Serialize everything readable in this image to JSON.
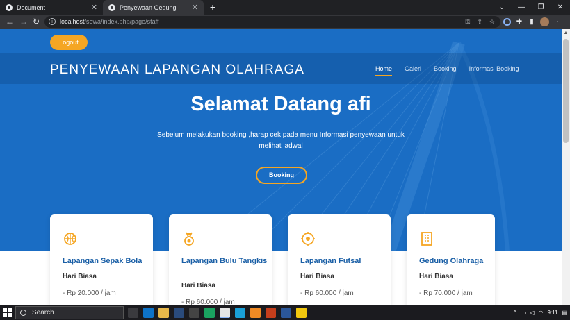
{
  "browser": {
    "tabs": [
      {
        "title": "Document",
        "active": false
      },
      {
        "title": "Penyewaan Gedung",
        "active": true
      }
    ],
    "new_tab": "+",
    "url_host": "localhost",
    "url_path": "/sewa/index.php/page/staff"
  },
  "page": {
    "logout_label": "Logout",
    "brand": "PENYEWAAN LAPANGAN OLAHRAGA",
    "nav": [
      "Home",
      "Galeri",
      "Booking",
      "Informasi Booking"
    ],
    "hero_title": "Selamat Datang afi",
    "hero_subtitle": "Sebelum melakukan booking ,harap cek pada menu Informasi penyewaan untuk melihat jadwal",
    "hero_button": "Booking",
    "cards": [
      {
        "icon": "basketball-icon",
        "title": "Lapangan Sepak Bola",
        "type": "Hari Biasa",
        "price": "- Rp 20.000 / jam"
      },
      {
        "icon": "medal-icon",
        "title": "Lapangan Bulu Tangkis",
        "type": "Hari Biasa",
        "price": "- Rp 60.000 / jam"
      },
      {
        "icon": "target-icon",
        "title": "Lapangan Futsal",
        "type": "Hari Biasa",
        "price": "- Rp 60.000 / jam"
      },
      {
        "icon": "building-icon",
        "title": "Gedung Olahraga",
        "type": "Hari Biasa",
        "price": "- Rp 70.000 / jam"
      }
    ]
  },
  "taskbar": {
    "search_label": "Search",
    "clock": "9:11"
  },
  "colors": {
    "hero_blue": "#1a6dc4",
    "accent_orange": "#f5a623",
    "card_title_blue": "#1a5fa6"
  }
}
